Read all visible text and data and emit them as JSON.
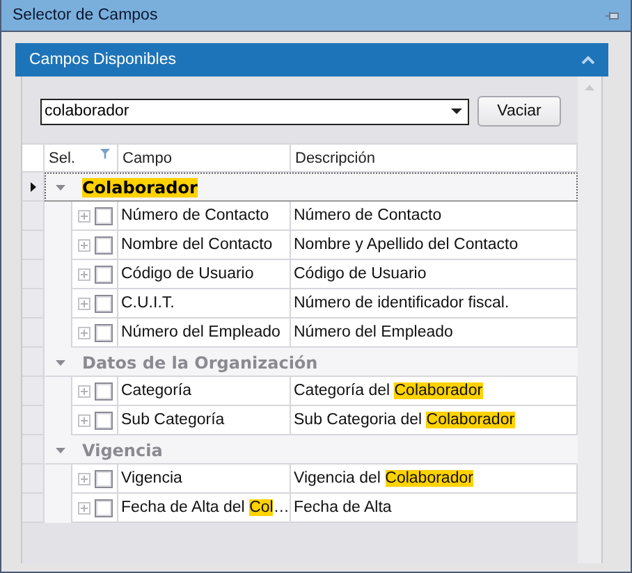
{
  "window": {
    "title": "Selector de Campos"
  },
  "panel": {
    "title": "Campos Disponibles",
    "expanded": true
  },
  "search": {
    "value": "colaborador"
  },
  "clear_button": "Vaciar",
  "columns": [
    "Sel.",
    "Campo",
    "Descripción"
  ],
  "groups": [
    {
      "title": "Colaborador",
      "highlight": true,
      "selected": true,
      "expanded": true,
      "rows": [
        {
          "checked": false,
          "field": "Número de Contacto",
          "description": "Número de Contacto"
        },
        {
          "checked": false,
          "field": "Nombre del Contacto",
          "description": "Nombre y Apellido del Contacto"
        },
        {
          "checked": false,
          "field": "Código de Usuario",
          "description": "Código de Usuario"
        },
        {
          "checked": false,
          "field": "C.U.I.T.",
          "description": "Número de identificador fiscal."
        },
        {
          "checked": false,
          "field": "Número del Empleado",
          "description": "Número del Empleado"
        }
      ]
    },
    {
      "title": "Datos de la Organización",
      "highlight": false,
      "selected": false,
      "expanded": true,
      "rows": [
        {
          "checked": false,
          "field": "Categoría",
          "description": [
            {
              "text": "Categoría del ",
              "highlight": false
            },
            {
              "text": "Colaborador",
              "highlight": true
            }
          ]
        },
        {
          "checked": false,
          "field": "Sub Categoría",
          "description": [
            {
              "text": "Sub Categoria del ",
              "highlight": false
            },
            {
              "text": "Colaborador",
              "highlight": true
            }
          ]
        }
      ]
    },
    {
      "title": "Vigencia",
      "highlight": false,
      "selected": false,
      "expanded": true,
      "rows": [
        {
          "checked": false,
          "field": "Vigencia",
          "description": [
            {
              "text": "Vigencia del ",
              "highlight": false
            },
            {
              "text": "Colaborador",
              "highlight": true
            }
          ]
        },
        {
          "checked": false,
          "field": [
            {
              "text": "Fecha de Alta del ",
              "highlight": false
            },
            {
              "text": "Col",
              "highlight": true
            },
            {
              "text": "…",
              "highlight": false
            }
          ],
          "description": "Fecha de Alta"
        }
      ]
    }
  ]
}
